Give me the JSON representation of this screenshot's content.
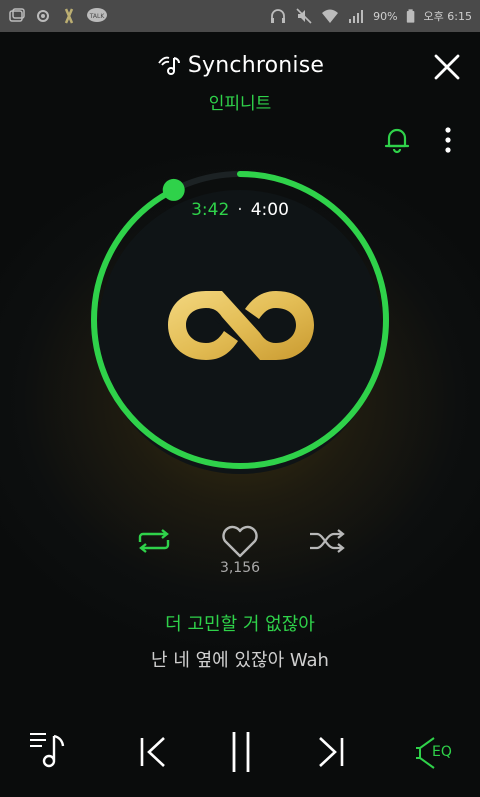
{
  "status_bar": {
    "battery": "90%",
    "time": "오후 6:15"
  },
  "header": {
    "title": "Synchronise",
    "artist": "인피니트"
  },
  "player": {
    "current_time": "3:42",
    "separator": "·",
    "total_time": "4:00",
    "progress": 0.925
  },
  "actions": {
    "like_count": "3,156"
  },
  "lyrics": {
    "current": "더 고민할 거 없잖아",
    "next": "난 네 옆에 있잖아 Wah"
  },
  "controls": {
    "eq_label": "EQ"
  },
  "colors": {
    "accent": "#2fd24a",
    "logo_gold": "#e6c25a",
    "background": "#0d0f0f"
  },
  "icons": {
    "close": "close-icon",
    "bell": "bell-icon",
    "more": "more-vertical-icon",
    "repeat": "repeat-icon",
    "like": "heart-icon",
    "shuffle": "shuffle-icon",
    "playlist": "playlist-icon",
    "previous": "previous-icon",
    "pause": "pause-icon",
    "next": "next-icon",
    "eq": "equalizer-icon"
  }
}
